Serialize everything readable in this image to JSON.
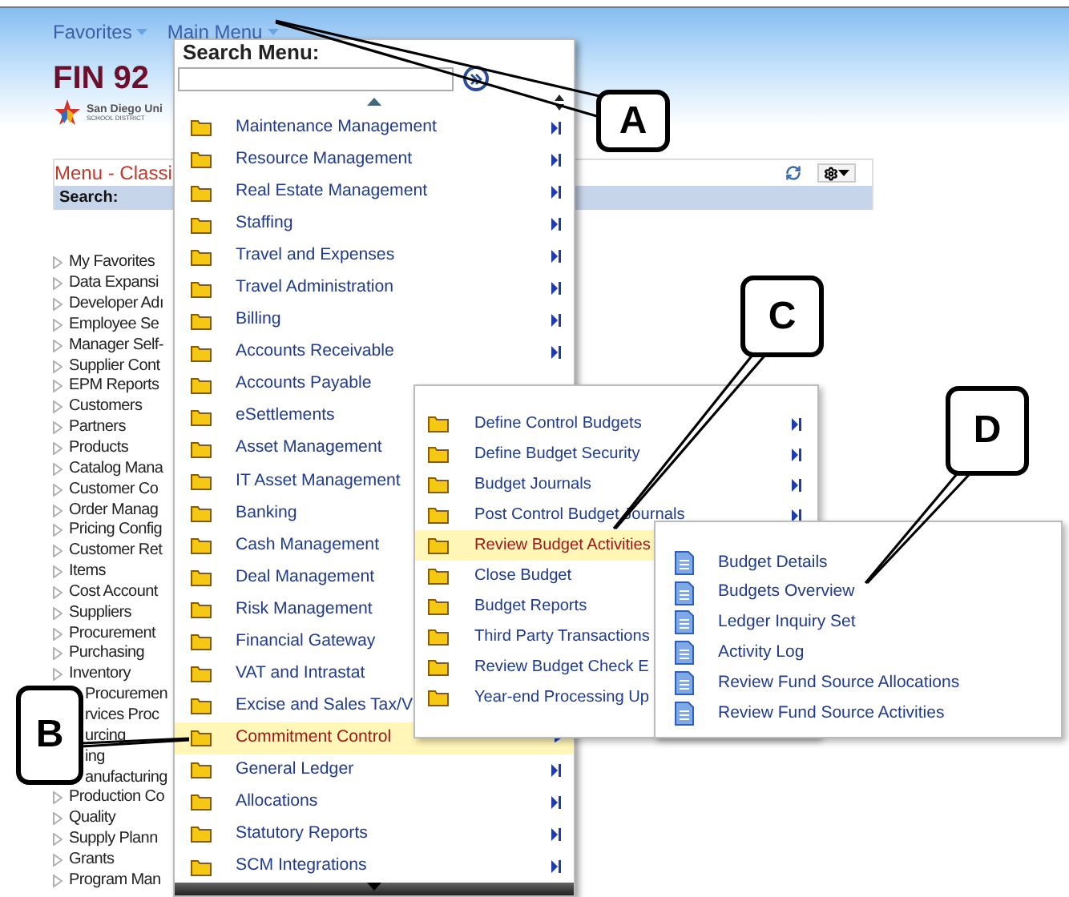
{
  "nav": [
    {
      "label": "Favorites"
    },
    {
      "label": "Main Menu"
    }
  ],
  "header": {
    "title": "FIN 92",
    "logo_name": "San Diego Uni",
    "logo_sub": "SCHOOL DISTRICT"
  },
  "pane": {
    "title": "Menu - Classi",
    "search_label": "Search:",
    "items": [
      {
        "label": "My Favorites",
        "partial": false
      },
      {
        "label": "Data Expansi",
        "partial": false
      },
      {
        "label": "Developer Adı",
        "partial": false
      },
      {
        "label": "Employee Se",
        "partial": false
      },
      {
        "label": "Manager Self-",
        "partial": false
      },
      {
        "label": "Supplier Cont",
        "partial": false
      },
      {
        "label": "EPM Reports",
        "partial": false
      },
      {
        "label": "Customers",
        "partial": false
      },
      {
        "label": "Partners",
        "partial": false
      },
      {
        "label": "Products",
        "partial": false
      },
      {
        "label": "Catalog Mana",
        "partial": false
      },
      {
        "label": "Customer Co",
        "partial": false
      },
      {
        "label": "Order Manag",
        "partial": false
      },
      {
        "label": "Pricing Config",
        "partial": false
      },
      {
        "label": "Customer Ret",
        "partial": false
      },
      {
        "label": "Items",
        "partial": false
      },
      {
        "label": "Cost Account",
        "partial": false
      },
      {
        "label": "Suppliers",
        "partial": false
      },
      {
        "label": "Procurement",
        "partial": false
      },
      {
        "label": "Purchasing",
        "partial": false
      },
      {
        "label": "Inventory",
        "partial": false
      },
      {
        "label": "Procuremen",
        "partial": true
      },
      {
        "label": "rvices Proc",
        "partial": true
      },
      {
        "label": "urcing",
        "partial": true
      },
      {
        "label": "ing",
        "partial": true
      },
      {
        "label": "anufacturing",
        "partial": true
      },
      {
        "label": "Production Co",
        "partial": false
      },
      {
        "label": "Quality",
        "partial": false
      },
      {
        "label": "Supply Plann",
        "partial": false
      },
      {
        "label": "Grants",
        "partial": false
      },
      {
        "label": "Program Man",
        "partial": false
      }
    ]
  },
  "main_menu": {
    "search_label": "Search Menu:",
    "items": [
      {
        "label": "Maintenance Management",
        "arrow": true,
        "selected": false
      },
      {
        "label": "Resource Management",
        "arrow": true,
        "selected": false
      },
      {
        "label": "Real Estate Management",
        "arrow": true,
        "selected": false
      },
      {
        "label": "Staffing",
        "arrow": true,
        "selected": false
      },
      {
        "label": "Travel and Expenses",
        "arrow": true,
        "selected": false
      },
      {
        "label": "Travel Administration",
        "arrow": true,
        "selected": false
      },
      {
        "label": "Billing",
        "arrow": true,
        "selected": false
      },
      {
        "label": "Accounts Receivable",
        "arrow": true,
        "selected": false
      },
      {
        "label": "Accounts Payable",
        "selected": false
      },
      {
        "label": "eSettlements",
        "selected": false
      },
      {
        "label": "Asset Management",
        "selected": false
      },
      {
        "label": "IT Asset Management",
        "selected": false
      },
      {
        "label": "Banking",
        "selected": false
      },
      {
        "label": "Cash Management",
        "selected": false
      },
      {
        "label": "Deal Management",
        "selected": false
      },
      {
        "label": "Risk Management",
        "selected": false
      },
      {
        "label": "Financial Gateway",
        "selected": false
      },
      {
        "label": "VAT and Intrastat",
        "selected": false
      },
      {
        "label": "Excise and Sales Tax/V",
        "selected": false
      },
      {
        "label": "Commitment Control",
        "arrow": true,
        "selected": true
      },
      {
        "label": "General Ledger",
        "arrow": true,
        "selected": false
      },
      {
        "label": "Allocations",
        "arrow": true,
        "selected": false
      },
      {
        "label": "Statutory Reports",
        "arrow": true,
        "selected": false
      },
      {
        "label": "SCM Integrations",
        "arrow": true,
        "selected": false
      }
    ]
  },
  "submenu": {
    "items": [
      {
        "label": "Define Control Budgets",
        "arrow": true,
        "selected": false
      },
      {
        "label": "Define Budget Security",
        "arrow": true,
        "selected": false
      },
      {
        "label": "Budget Journals",
        "arrow": true,
        "selected": false
      },
      {
        "label": "Post Control Budget Journals",
        "arrow": true,
        "selected": false
      },
      {
        "label": "Review Budget Activities",
        "selected": true
      },
      {
        "label": "Close Budget",
        "selected": false
      },
      {
        "label": "Budget Reports",
        "selected": false
      },
      {
        "label": "Third Party Transactions",
        "selected": false
      },
      {
        "label": "Review Budget Check E",
        "selected": false
      },
      {
        "label": "Year-end Processing Up",
        "selected": false
      }
    ]
  },
  "pages": {
    "items": [
      {
        "label": "Budget Details"
      },
      {
        "label": "Budgets Overview"
      },
      {
        "label": "Ledger Inquiry Set"
      },
      {
        "label": "Activity Log"
      },
      {
        "label": "Review Fund Source Allocations"
      },
      {
        "label": "Review Fund Source Activities"
      }
    ]
  },
  "callouts": [
    {
      "label": "A"
    },
    {
      "label": "B"
    },
    {
      "label": "C"
    },
    {
      "label": "D"
    }
  ]
}
